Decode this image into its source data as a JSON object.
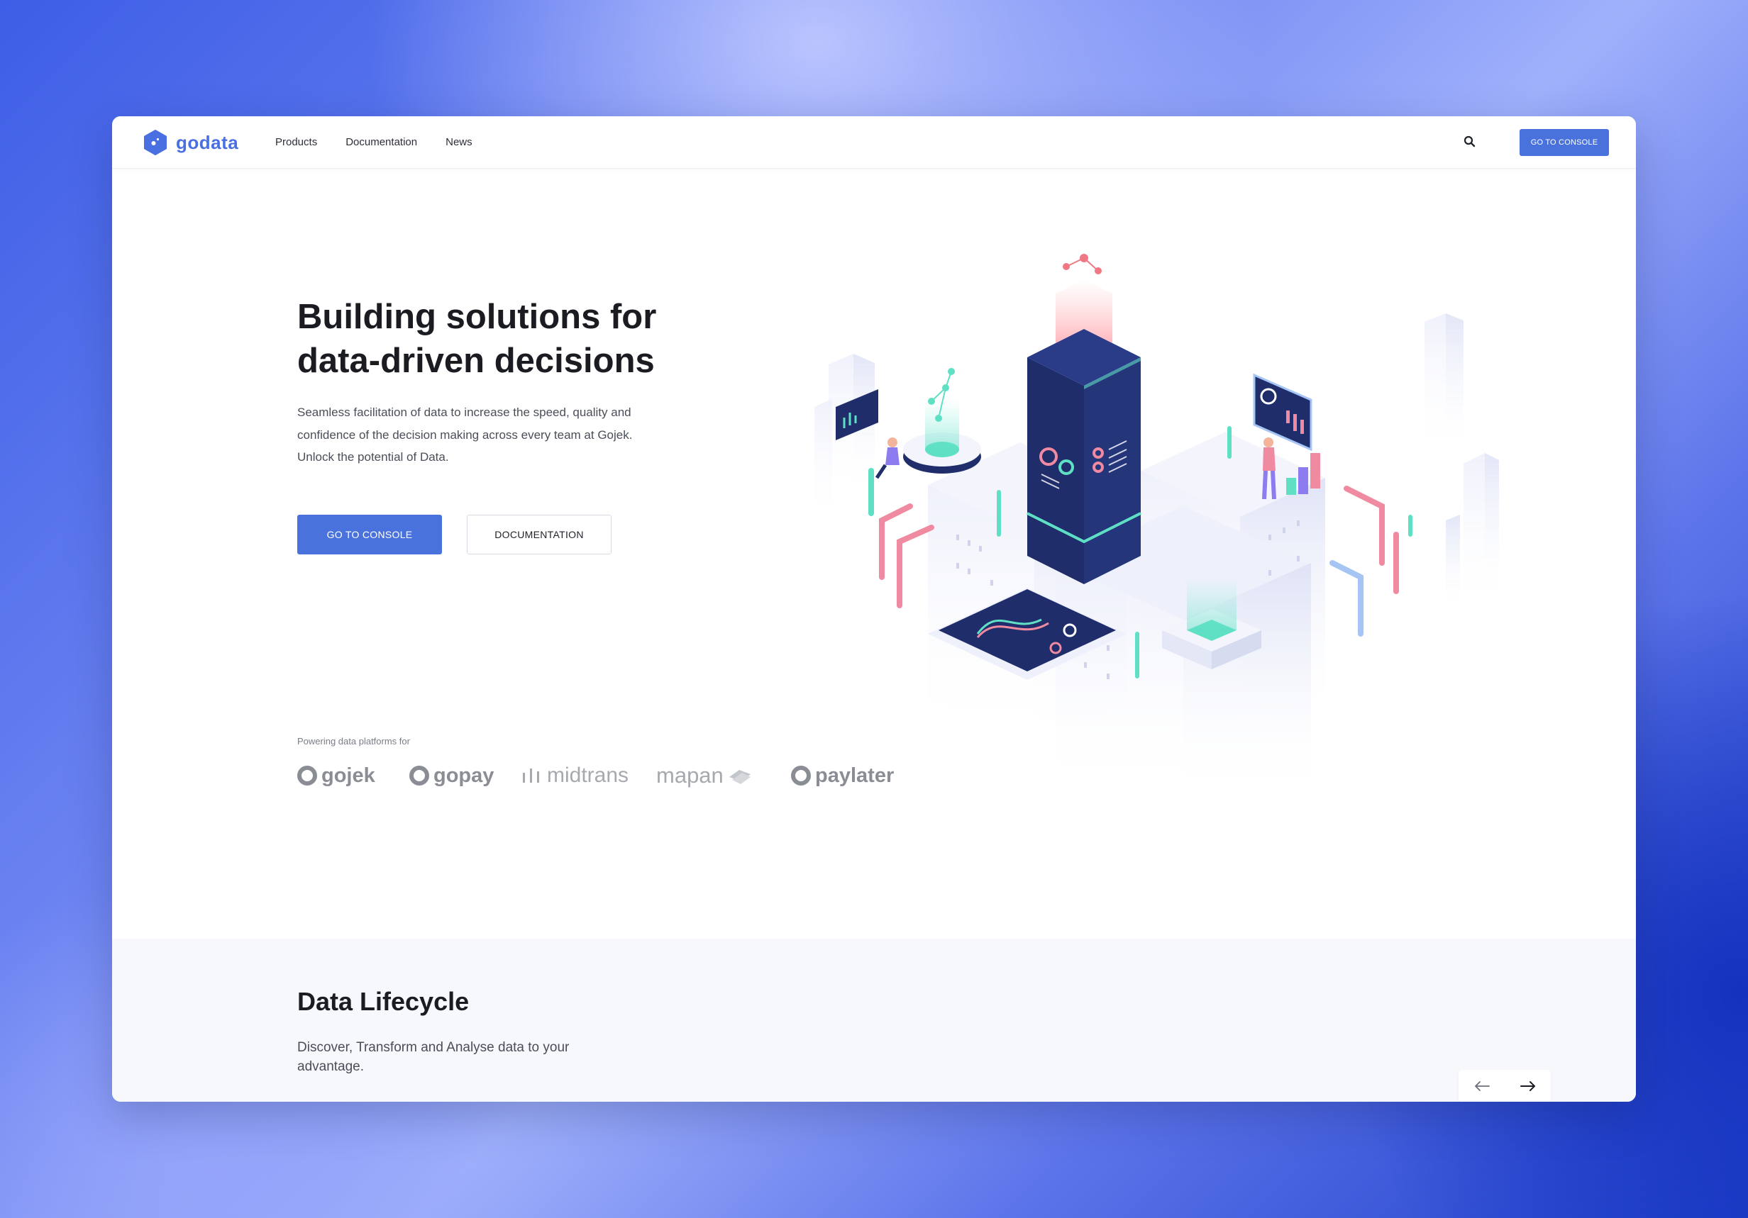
{
  "header": {
    "logo_text": "godata",
    "nav": [
      "Products",
      "Documentation",
      "News"
    ],
    "console_button": "GO TO CONSOLE"
  },
  "hero": {
    "title": "Building solutions for data-driven decisions",
    "description": "Seamless facilitation of data to increase the speed, quality and confidence of the decision making across every team at Gojek. Unlock the potential of Data.",
    "primary_button": "GO TO CONSOLE",
    "secondary_button": "DOCUMENTATION"
  },
  "partners": {
    "label": "Powering data platforms for",
    "logos": [
      "gojek",
      "gopay",
      "midtrans",
      "mapan",
      "paylater"
    ]
  },
  "lifecycle": {
    "title": "Data Lifecycle",
    "description": "Discover, Transform and Analyse data to your advantage."
  },
  "colors": {
    "accent": "#4a72dd",
    "navy": "#1f2d6b",
    "mint": "#5fe0c4",
    "pink": "#f08aa0"
  }
}
